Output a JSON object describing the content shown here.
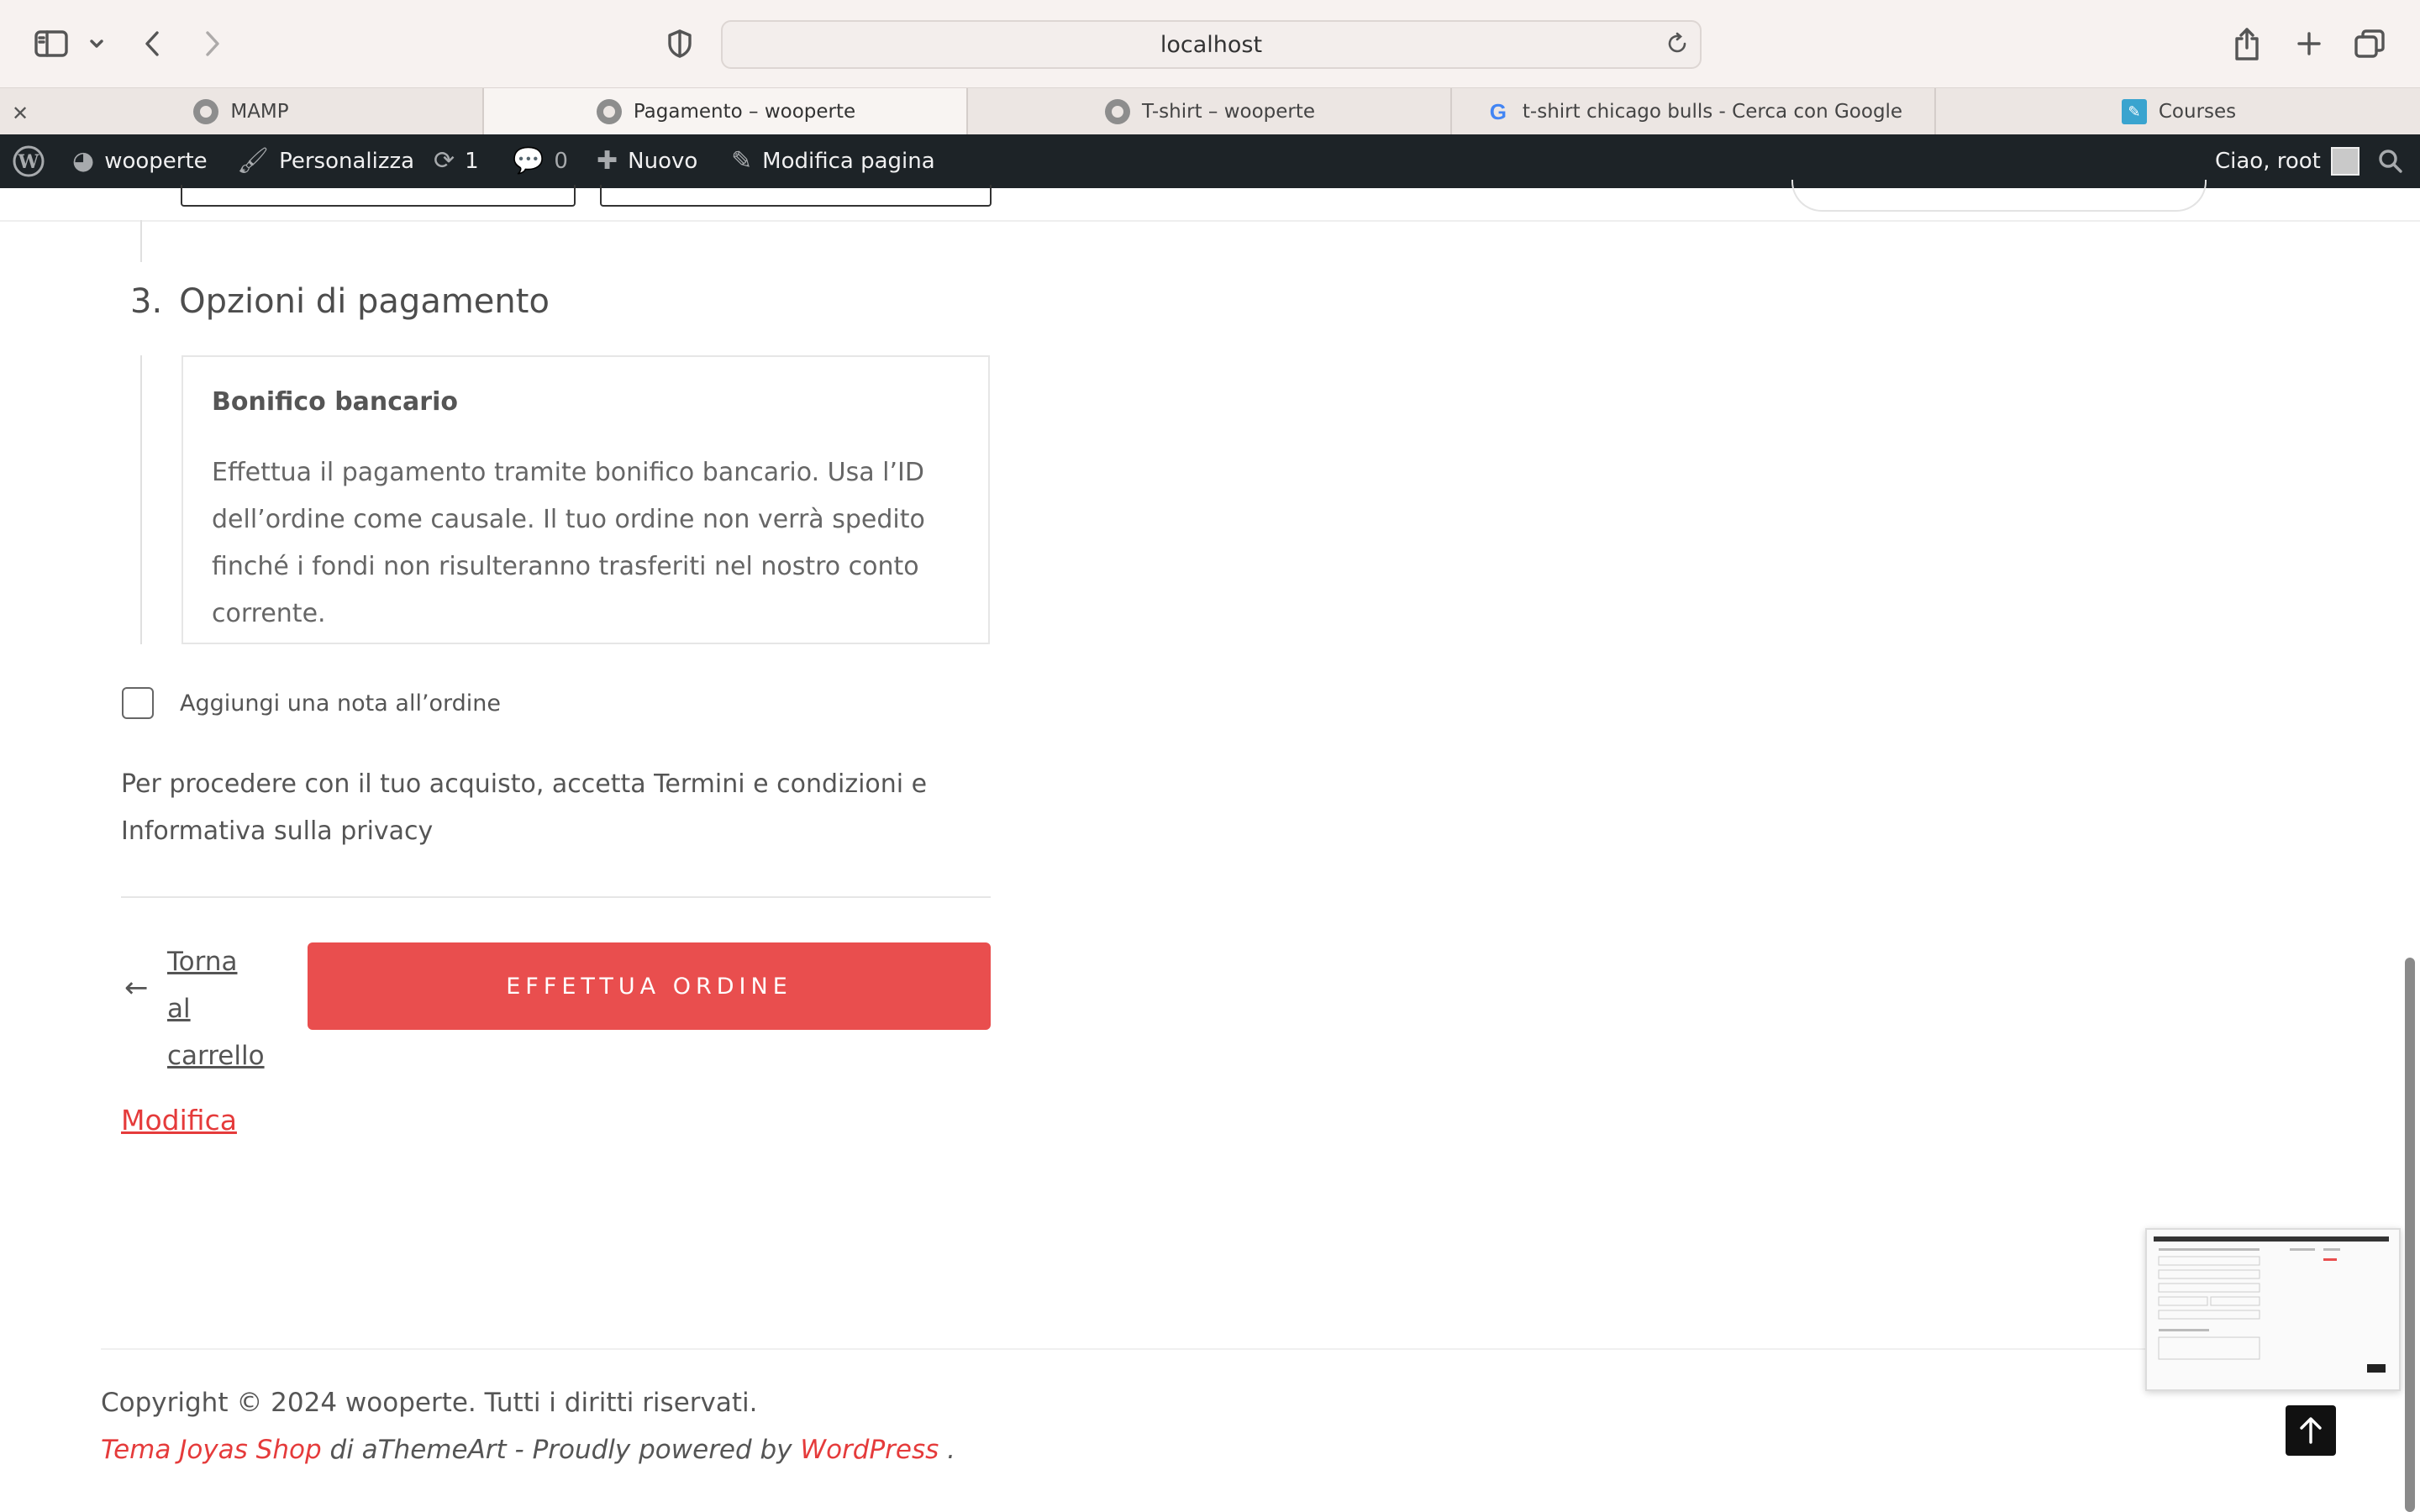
{
  "browser": {
    "url": "localhost",
    "tabs": [
      {
        "label": "MAMP",
        "active": false
      },
      {
        "label": "Pagamento – wooperte",
        "active": true
      },
      {
        "label": "T-shirt – wooperte",
        "active": false
      },
      {
        "label": "t-shirt chicago bulls - Cerca con Google",
        "active": false
      },
      {
        "label": "Courses",
        "active": false
      }
    ]
  },
  "adminbar": {
    "site": "wooperte",
    "customize": "Personalizza",
    "updates": "1",
    "comments": "0",
    "new": "Nuovo",
    "edit_page": "Modifica pagina",
    "greeting": "Ciao, root"
  },
  "checkout": {
    "step_number": "3.",
    "step_title": "Opzioni di pagamento",
    "payment_method": "Bonifico bancario",
    "payment_description": "Effettua il pagamento tramite bonifico bancario. Usa l’ID dell’ordine come causale. Il tuo ordine non verrà spedito finché i fondi non risulteranno trasferiti nel nostro conto corrente.",
    "order_note_label": "Aggiungi una nota all’ordine",
    "terms_text": "Per procedere con il tuo acquisto, accetta Termini e condizioni e Informativa sulla privacy",
    "back_link": "Torna al carrello",
    "place_order": "EFFETTUA ORDINE",
    "edit_link": "Modifica"
  },
  "footer": {
    "copyright": "Copyright © 2024 wooperte. Tutti i diritti riservati.",
    "theme_link": "Tema Joyas Shop",
    "by_text": " di aThemeArt - Proudly powered by ",
    "wp_link": "WordPress",
    "end": " ."
  },
  "colors": {
    "accent": "#e94e4e",
    "adminbar": "#1d2327"
  }
}
